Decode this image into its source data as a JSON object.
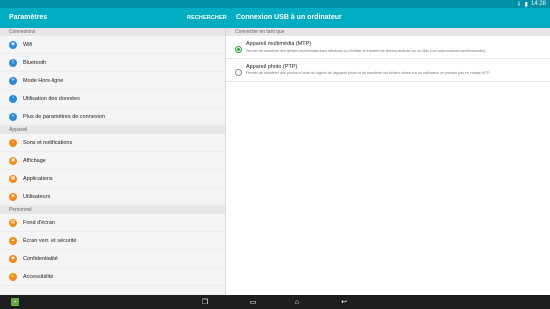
{
  "status": {
    "time": "14:28",
    "battery_icon": "battery-icon",
    "download_icon": "download-icon"
  },
  "appbar": {
    "left_title": "Paramètres",
    "search_label": "RECHERCHER",
    "right_title": "Connexion USB à un ordinateur"
  },
  "sections": [
    {
      "header": "Connexions",
      "items": [
        {
          "label": "Wifi",
          "icon": "wifi-icon",
          "color": "#2d8bd6"
        },
        {
          "label": "Bluetooth",
          "icon": "bluetooth-icon",
          "color": "#2d8bd6"
        },
        {
          "label": "Mode Hors-ligne",
          "icon": "airplane-icon",
          "color": "#2d8bd6"
        },
        {
          "label": "Utilisation des données",
          "icon": "data-usage-icon",
          "color": "#2d8bd6"
        },
        {
          "label": "Plus de paramètres de connexion",
          "icon": "more-connections-icon",
          "color": "#2d8bd6"
        }
      ]
    },
    {
      "header": "Appareil",
      "items": [
        {
          "label": "Sons et notifications",
          "icon": "sound-icon",
          "color": "#f28a1c"
        },
        {
          "label": "Affichage",
          "icon": "display-icon",
          "color": "#f28a1c"
        },
        {
          "label": "Applications",
          "icon": "apps-icon",
          "color": "#f28a1c"
        },
        {
          "label": "Utilisateurs",
          "icon": "users-icon",
          "color": "#f28a1c"
        }
      ]
    },
    {
      "header": "Personnel",
      "items": [
        {
          "label": "Fond d'écran",
          "icon": "wallpaper-icon",
          "color": "#f28a1c"
        },
        {
          "label": "Écran verr. et sécurité",
          "icon": "lock-icon",
          "color": "#f28a1c"
        },
        {
          "label": "Confidentialité",
          "icon": "privacy-icon",
          "color": "#f28a1c"
        },
        {
          "label": "Accessibilité",
          "icon": "accessibility-icon",
          "color": "#f28a1c"
        }
      ]
    }
  ],
  "detail": {
    "header": "Connecter en tant que",
    "options": [
      {
        "title": "Appareil multimédia (MTP)",
        "desc": "Permet de transférer des fichiers multimédias dans Windows ou d'utiliser le transfert de fichiers Android sur un Mac (voir www.android.com/filetransfer).",
        "selected": true
      },
      {
        "title": "Appareil photo (PTP)",
        "desc": "Permet de transférer des photos à l'aide du logiciel de l'appareil photo et de transférer les fichiers situés sur un ordinateur ne prenant pas en charge MTP.",
        "selected": false
      }
    ]
  },
  "navbar": {
    "icons": [
      "gallery-icon",
      "recents-icon",
      "screenshot-icon",
      "home-icon",
      "back-icon"
    ]
  },
  "colors": {
    "statusbar": "#008fa5",
    "appbar": "#00acc1",
    "connections": "#2d8bd6",
    "device": "#f28a1c",
    "selected_radio": "#2e9e36"
  }
}
